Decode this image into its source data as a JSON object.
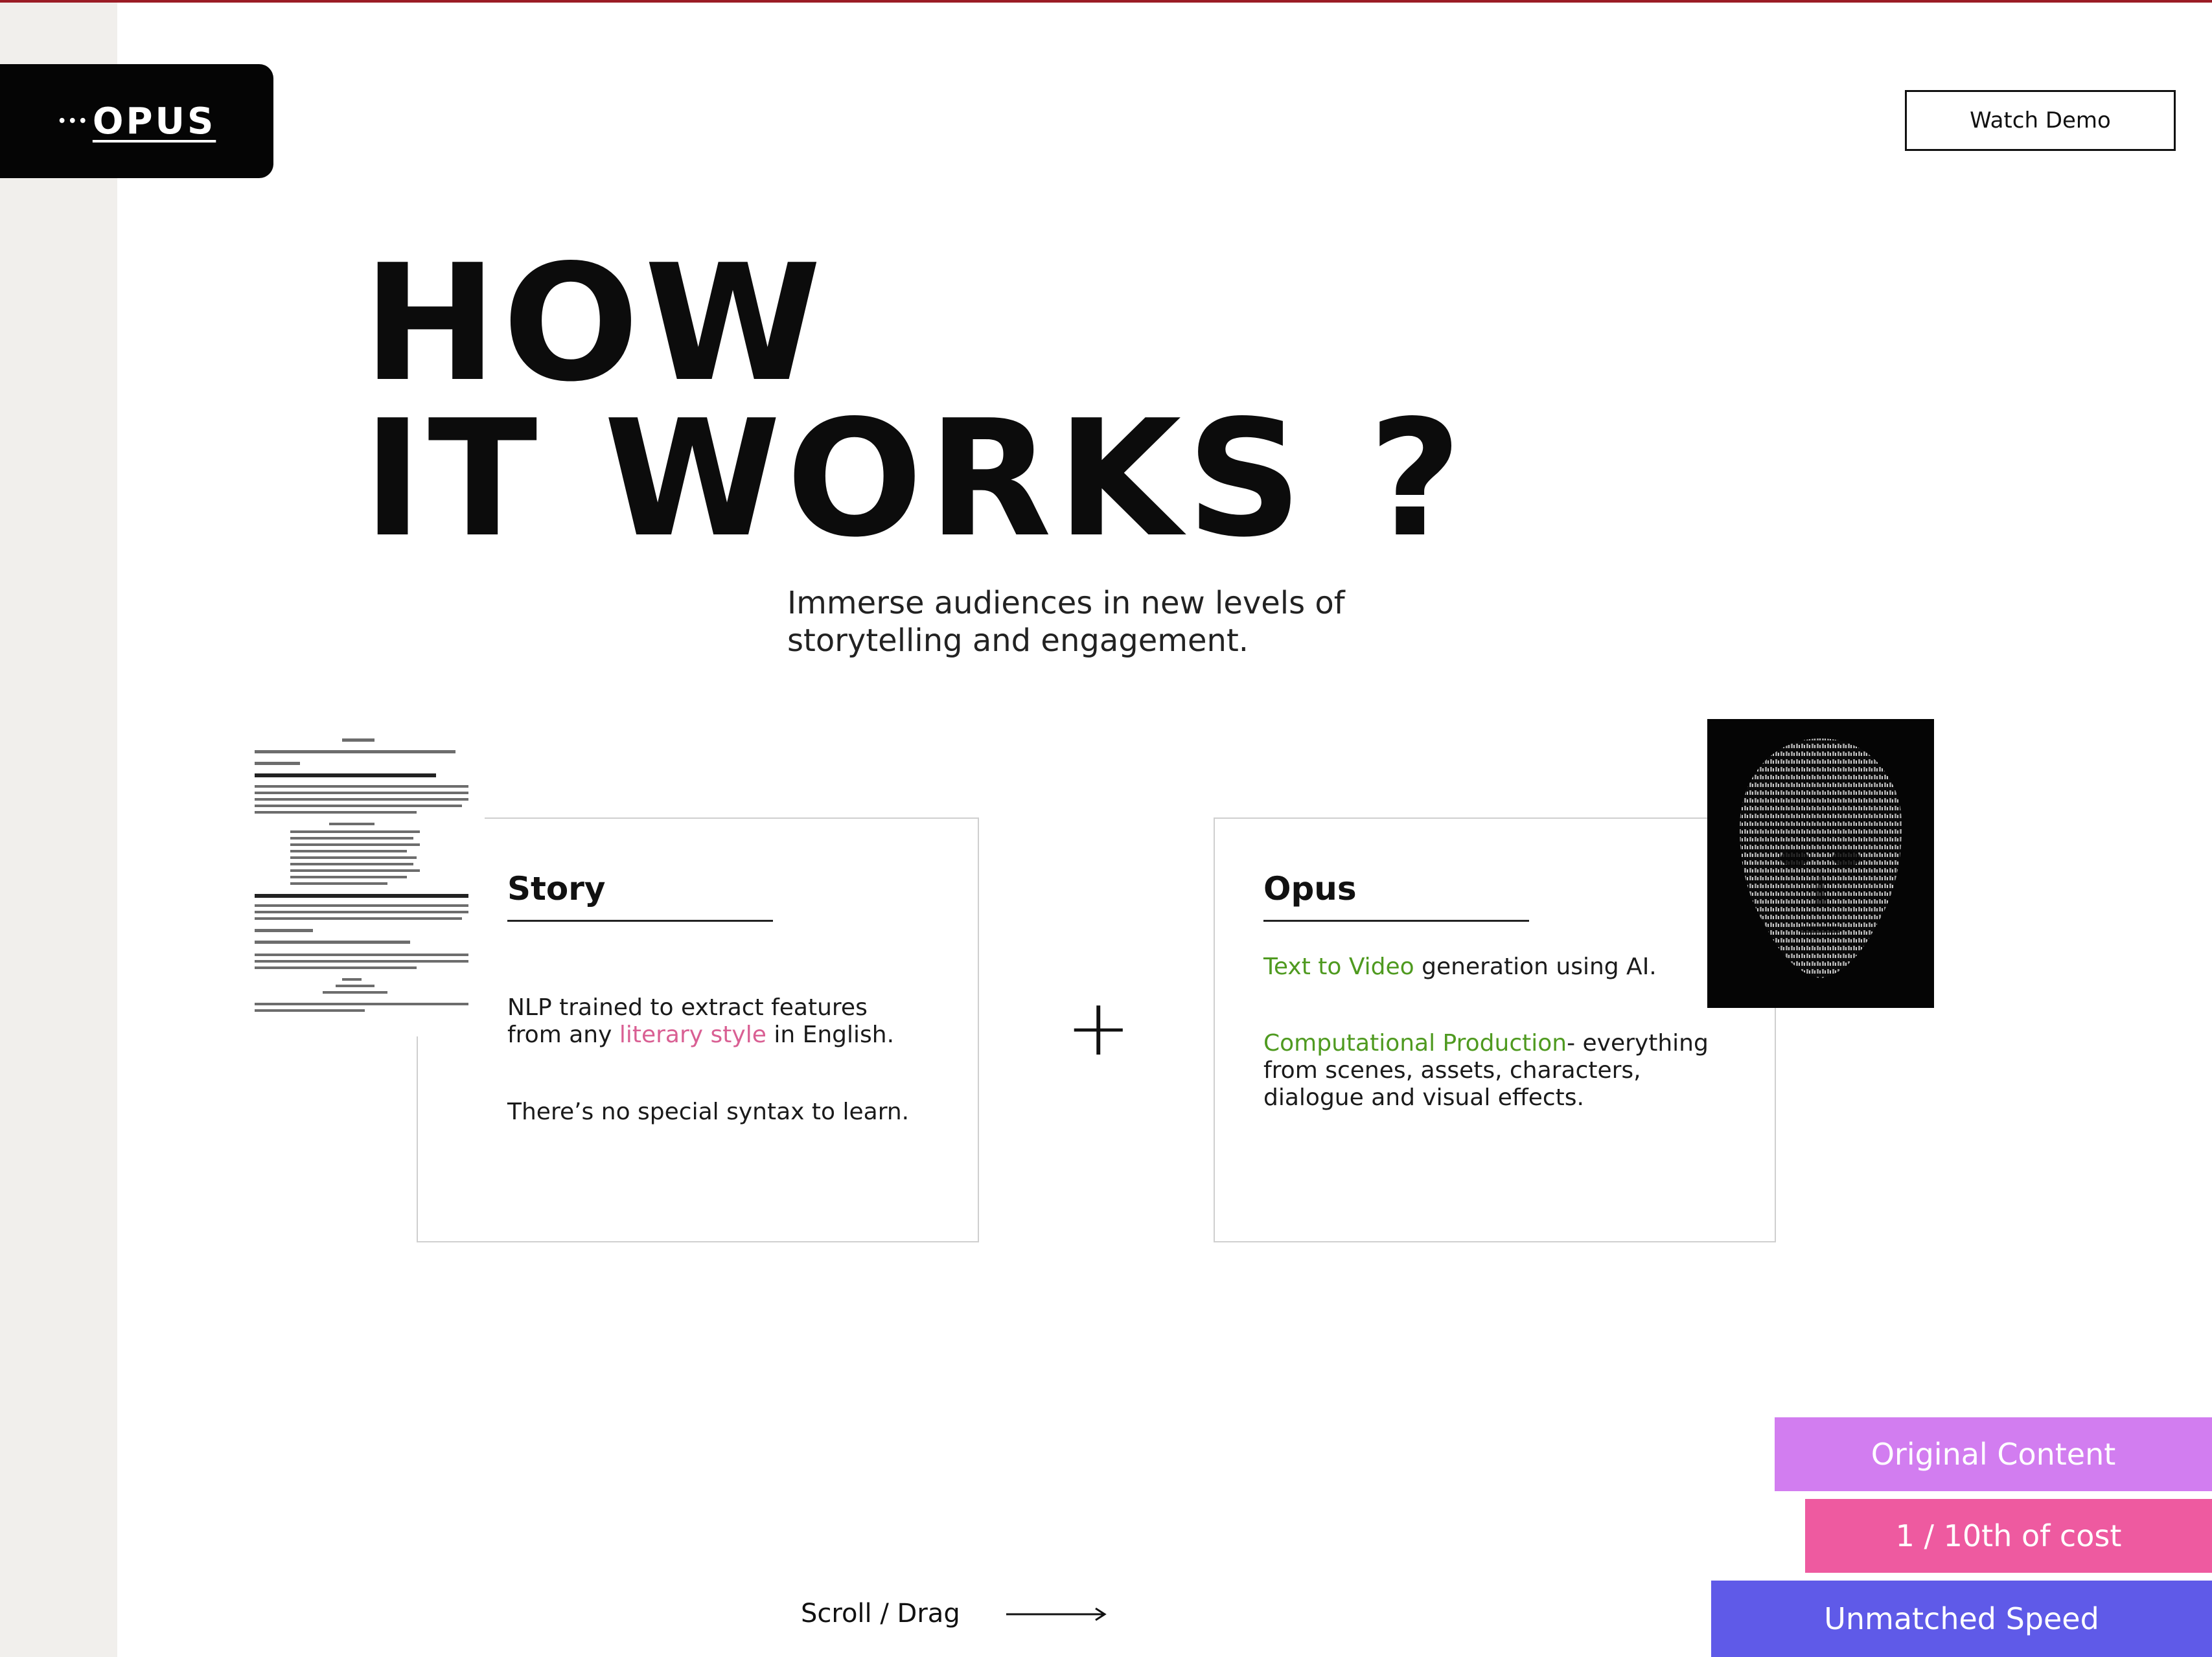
{
  "header": {
    "logo_text": "OPUS",
    "logo_dots": "•••",
    "watch_demo_label": "Watch Demo"
  },
  "hero": {
    "title_line1": "HOW",
    "title_line2": "IT WORKS ?",
    "subtitle_line1": "Immerse audiences in new levels of",
    "subtitle_line2": "storytelling and engagement."
  },
  "story_card": {
    "title": "Story",
    "line1_prefix": "NLP trained to extract features",
    "line2_prefix": "from any ",
    "line2_highlight": "literary style",
    "line2_suffix": " in English.",
    "line3": "There’s no special syntax to learn.",
    "highlight_color": "#d95f93"
  },
  "plus_sign": "+",
  "opus_card": {
    "title": "Opus",
    "p1_highlight": "Text to Video",
    "p1_suffix": " generation using AI.",
    "p2_highlight": "Computational Production",
    "p2_line1_suffix": "- everything",
    "p2_line2": "from scenes, assets, characters,",
    "p2_line3": "dialogue and visual effects.",
    "highlight_color": "#4f9a20"
  },
  "scroll_hint": {
    "label": "Scroll / Drag"
  },
  "tags": [
    {
      "label": "Original Content",
      "color": "#d27df0"
    },
    {
      "label": "1 / 10th of cost",
      "color": "#ee5aa0"
    },
    {
      "label": "Unmatched Speed",
      "color": "#5f5ae8"
    }
  ],
  "images": {
    "script_page": "screenplay-page-image",
    "face": "ascii-art-face-image"
  }
}
